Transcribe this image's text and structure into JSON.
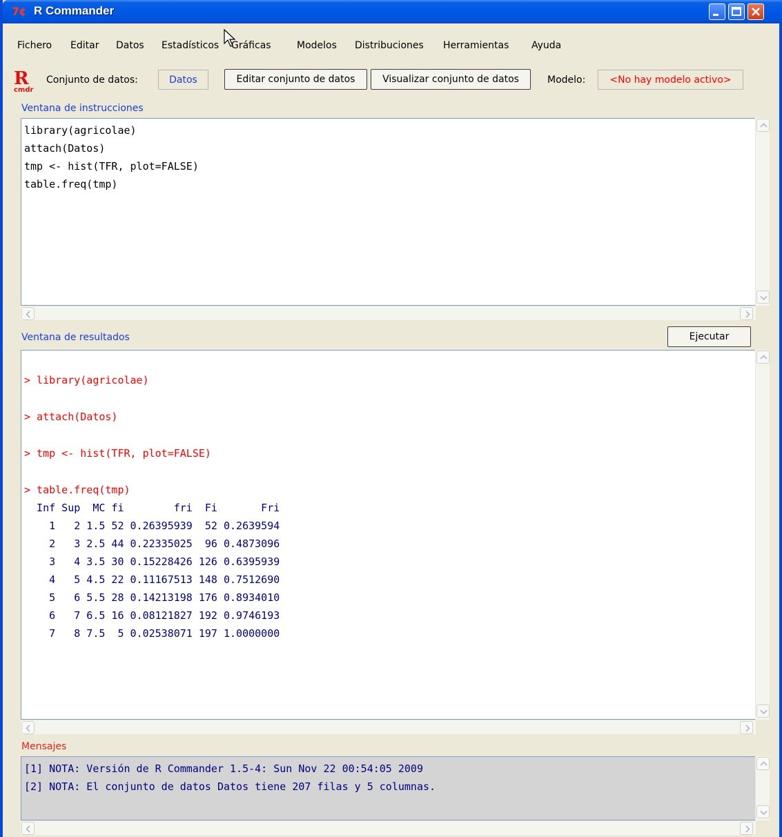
{
  "window": {
    "title": "R Commander",
    "icon_text": "7¢"
  },
  "menu": [
    "Fichero",
    "Editar",
    "Datos",
    "Estadísticos",
    "Gráficas",
    "Modelos",
    "Distribuciones",
    "Herramientas",
    "Ayuda"
  ],
  "toolbar": {
    "dataset_label": "Conjunto de datos:",
    "dataset_value": "Datos",
    "edit_button": "Editar conjunto de datos",
    "view_button": "Visualizar conjunto de datos",
    "model_label": "Modelo:",
    "model_value": "<No hay modelo activo>"
  },
  "script_window": {
    "label": "Ventana de instrucciones",
    "lines": [
      "library(agricolae)",
      "attach(Datos)",
      "tmp <- hist(TFR, plot=FALSE)",
      "table.freq(tmp)"
    ]
  },
  "output_window": {
    "label": "Ventana de resultados",
    "run_button": "Ejecutar",
    "commands": [
      "> library(agricolae)",
      "> attach(Datos)",
      "> tmp <- hist(TFR, plot=FALSE)",
      "> table.freq(tmp)"
    ],
    "table_header": "  Inf Sup  MC fi        fri  Fi       Fri",
    "table_rows": [
      "    1   2 1.5 52 0.26395939  52 0.2639594",
      "    2   3 2.5 44 0.22335025  96 0.4873096",
      "    3   4 3.5 30 0.15228426 126 0.6395939",
      "    4   5 4.5 22 0.11167513 148 0.7512690",
      "    5   6 5.5 28 0.14213198 176 0.8934010",
      "    6   7 6.5 16 0.08121827 192 0.9746193",
      "    7   8 7.5  5 0.02538071 197 1.0000000"
    ]
  },
  "messages": {
    "label": "Mensajes",
    "lines": [
      "[1] NOTA: Versión de R Commander 1.5-4: Sun Nov 22 00:54:05 2009",
      "[2] NOTA: El conjunto de datos Datos tiene 207 filas y 5 columnas."
    ]
  },
  "colors": {
    "titlebar": "#0058e6",
    "section_label": "#1a3fd6",
    "command_text": "#ff0000",
    "output_text": "#000080",
    "model_text": "#ff0000"
  }
}
